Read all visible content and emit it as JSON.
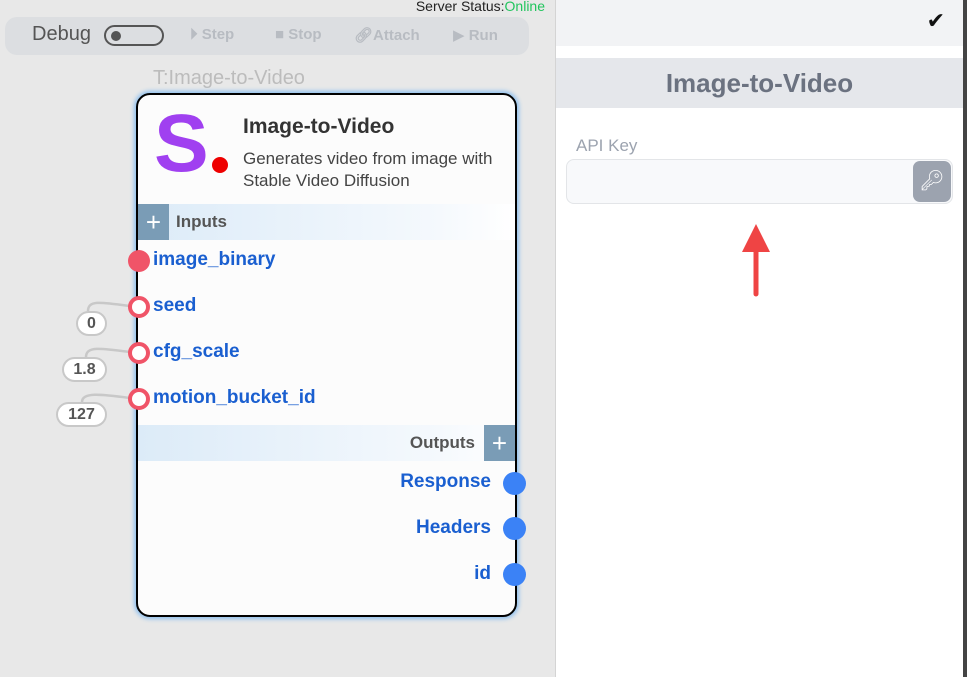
{
  "status": {
    "label": "Server Status:",
    "value": "Online",
    "color": "#22c55e"
  },
  "toolbar": {
    "debug": "Debug",
    "step": "Step",
    "stop": "Stop",
    "attach": "Attach",
    "run": "Run"
  },
  "node": {
    "tag": "T:Image-to-Video",
    "logo": "S",
    "title": "Image-to-Video",
    "description": "Generates video from image with Stable Video Diffusion",
    "inputs_label": "Inputs",
    "outputs_label": "Outputs",
    "inputs": [
      {
        "name": "image_binary"
      },
      {
        "name": "seed",
        "value": "0"
      },
      {
        "name": "cfg_scale",
        "value": "1.8"
      },
      {
        "name": "motion_bucket_id",
        "value": "127"
      }
    ],
    "outputs": [
      "Response",
      "Headers",
      "id"
    ]
  },
  "panel": {
    "title": "Image-to-Video",
    "api_key_label": "API Key",
    "api_key_value": "",
    "confirm_icon": "check-icon",
    "key_icon": "key-icon"
  }
}
